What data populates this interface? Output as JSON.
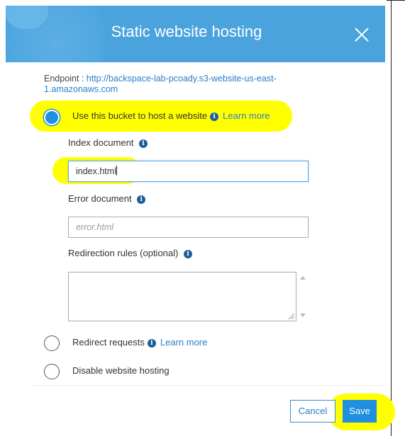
{
  "dialog": {
    "title": "Static website hosting",
    "endpoint_label": "Endpoint : ",
    "endpoint_url": "http://backspace-lab-pcoady.s3-website-us-east-1.amazonaws.com"
  },
  "options": {
    "host": {
      "label": "Use this bucket to host a website",
      "learn_more": "Learn more",
      "selected": true
    },
    "redirect": {
      "label": "Redirect requests",
      "learn_more": "Learn more",
      "selected": false
    },
    "disable": {
      "label": "Disable website hosting",
      "selected": false
    }
  },
  "fields": {
    "index_label": "Index document",
    "index_value": "index.html",
    "error_label": "Error document",
    "error_placeholder": "error.html",
    "redirection_label": "Redirection rules (optional)",
    "redirection_value": ""
  },
  "buttons": {
    "cancel": "Cancel",
    "save": "Save"
  },
  "colors": {
    "header": "#4aa3dd",
    "accent": "#1f8fe0",
    "link": "#2a7fc9",
    "highlight": "#ffff00"
  },
  "icons": {
    "close": "close-icon",
    "info": "info-icon"
  }
}
